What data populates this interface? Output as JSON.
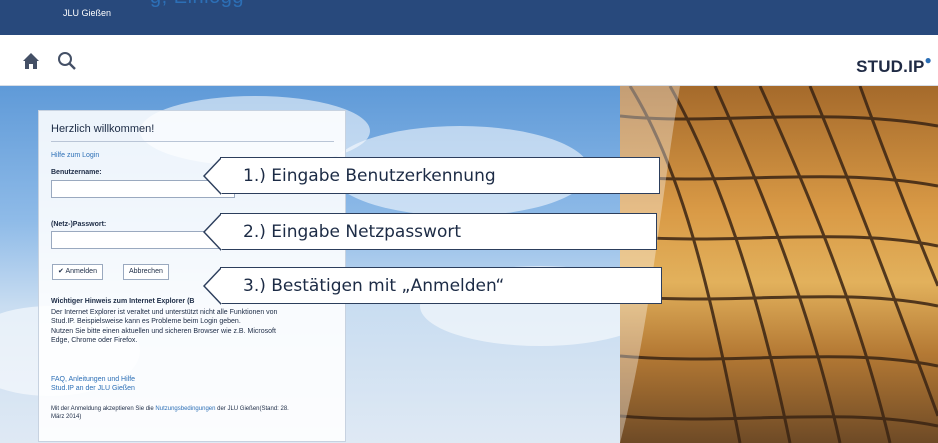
{
  "header": {
    "caption_fragment": "g, Einlogg",
    "institution": "JLU Gießen"
  },
  "toolbar": {
    "home_icon": "home-icon",
    "search_icon": "search-icon",
    "logo_text": "STUD.IP"
  },
  "login": {
    "title": "Herzlich willkommen!",
    "help_link": "Hilfe zum Login",
    "username_label": "Benutzername:",
    "username_value": "",
    "password_label": "(Netz-)Passwort:",
    "password_value": "",
    "login_button": "Anmelden",
    "cancel_button": "Abbrechen",
    "ie_heading": "Wichtiger Hinweis zum Internet Explorer (B",
    "ie_text_1": "Der Internet Explorer ist veraltet und unterstützt nicht alle Funktionen von",
    "ie_text_2": "Stud.IP. Beispielsweise kann es Probleme beim Login geben.",
    "ie_text_3": "Nutzen Sie bitte einen aktuellen und sicheren Browser wie z.B. Microsoft",
    "ie_text_4": "Edge, Chrome oder Firefox.",
    "faq_link": "FAQ, Anleitungen und Hilfe",
    "studip_link": "Stud.IP an der JLU Gießen",
    "terms_prefix": "Mit der Anmeldung akzeptieren Sie die ",
    "terms_link": "Nutzungsbedingungen",
    "terms_suffix": " der JLU Gießen(Stand: 28.",
    "terms_line2": "März 2014)"
  },
  "callouts": [
    {
      "text": "1.) Eingabe Benutzerkennung"
    },
    {
      "text": "2.) Eingabe Netzpasswort"
    },
    {
      "text": "3.) Bestätigen mit „Anmelden“"
    }
  ],
  "colors": {
    "topbar": "#28497c",
    "accent": "#2c6fb6",
    "text": "#1c2b45"
  }
}
